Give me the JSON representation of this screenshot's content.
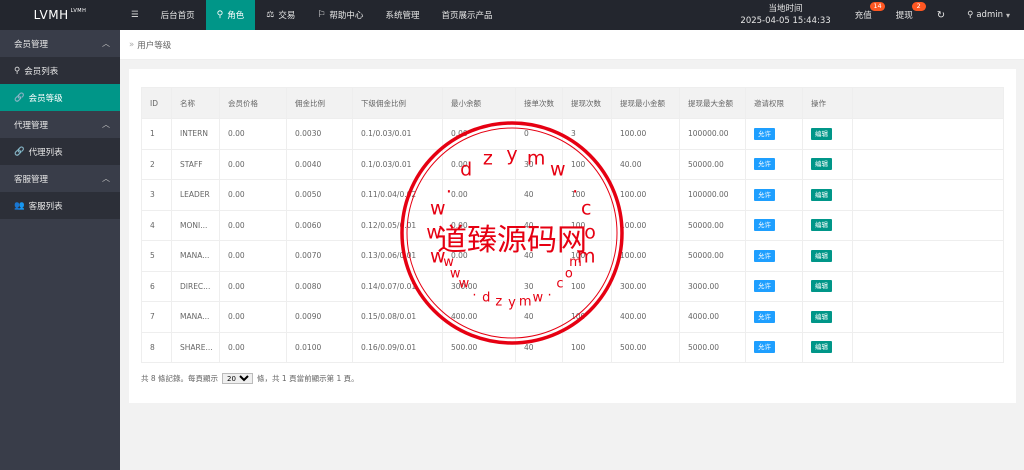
{
  "app": {
    "logo": "LVMH",
    "logo_sup": "LVMH"
  },
  "topnav": [
    {
      "label": "后台首页",
      "icon": "",
      "active": false
    },
    {
      "label": "角色",
      "icon": "user-icon",
      "active": true
    },
    {
      "label": "交易",
      "icon": "scale-icon",
      "active": false
    },
    {
      "label": "帮助中心",
      "icon": "flag-icon",
      "active": false
    },
    {
      "label": "系统管理",
      "icon": "",
      "active": false
    },
    {
      "label": "首页展示产品",
      "icon": "",
      "active": false
    }
  ],
  "header": {
    "time_label": "当地时间",
    "time_value": "2025-04-05 15:44:33",
    "recharge_label": "充值",
    "recharge_badge": "14",
    "withdraw_label": "提现",
    "withdraw_badge": "2",
    "user": "admin"
  },
  "sidebar": {
    "groups": [
      {
        "label": "会员管理",
        "items": [
          {
            "label": "会员列表",
            "icon": "user-icon",
            "active": false
          },
          {
            "label": "会员等级",
            "icon": "link-icon",
            "active": true
          }
        ]
      },
      {
        "label": "代理管理",
        "items": [
          {
            "label": "代理列表",
            "icon": "link-icon",
            "active": false
          }
        ]
      },
      {
        "label": "客服管理",
        "items": [
          {
            "label": "客服列表",
            "icon": "users-icon",
            "active": false
          }
        ]
      }
    ]
  },
  "breadcrumb": {
    "sep": "»",
    "current": "用户等级"
  },
  "table": {
    "columns": [
      "ID",
      "名称",
      "会员价格",
      "佣金比例",
      "下级佣金比例",
      "最小余额",
      "接单次数",
      "提现次数",
      "提现最小金额",
      "提现最大金额",
      "邀请权限",
      "操作"
    ],
    "rows": [
      [
        "1",
        "INTERN",
        "0.00",
        "0.0030",
        "0.1/0.03/0.01",
        "0.00",
        "0",
        "3",
        "100.00",
        "100000.00"
      ],
      [
        "2",
        "STAFF",
        "0.00",
        "0.0040",
        "0.1/0.03/0.01",
        "0.00",
        "30",
        "100",
        "40.00",
        "50000.00"
      ],
      [
        "3",
        "LEADER",
        "0.00",
        "0.0050",
        "0.11/0.04/0.02",
        "0.00",
        "40",
        "100",
        "100.00",
        "100000.00"
      ],
      [
        "4",
        "MONI...",
        "0.00",
        "0.0060",
        "0.12/0.05/0.01",
        "0.00",
        "40",
        "100",
        "100.00",
        "50000.00"
      ],
      [
        "5",
        "MANA...",
        "0.00",
        "0.0070",
        "0.13/0.06/0.01",
        "0.00",
        "40",
        "100",
        "100.00",
        "50000.00"
      ],
      [
        "6",
        "DIREC...",
        "0.00",
        "0.0080",
        "0.14/0.07/0.01",
        "300.00",
        "30",
        "100",
        "300.00",
        "3000.00"
      ],
      [
        "7",
        "MANA...",
        "0.00",
        "0.0090",
        "0.15/0.08/0.01",
        "400.00",
        "40",
        "100",
        "400.00",
        "4000.00"
      ],
      [
        "8",
        "SHARE...",
        "0.00",
        "0.0100",
        "0.16/0.09/0.01",
        "500.00",
        "40",
        "100",
        "500.00",
        "5000.00"
      ]
    ],
    "allow_label": "允许",
    "edit_label": "编辑"
  },
  "pager": {
    "prefix": "共 8 條記錄。每頁顯示",
    "per_page": "20",
    "suffix": "條，共 1 頁當前顯示第 1 頁。"
  },
  "watermark": {
    "text": "道臻源码网",
    "url_chars": [
      "w",
      "w",
      "w",
      ".",
      "d",
      "z",
      "y",
      "m",
      "w",
      ".",
      "c",
      "o",
      "m"
    ]
  },
  "colors": {
    "topbar": "#23262e",
    "sidebar": "#393d49",
    "accent": "#009688",
    "blue": "#1e9fff",
    "stamp": "#e60012"
  }
}
